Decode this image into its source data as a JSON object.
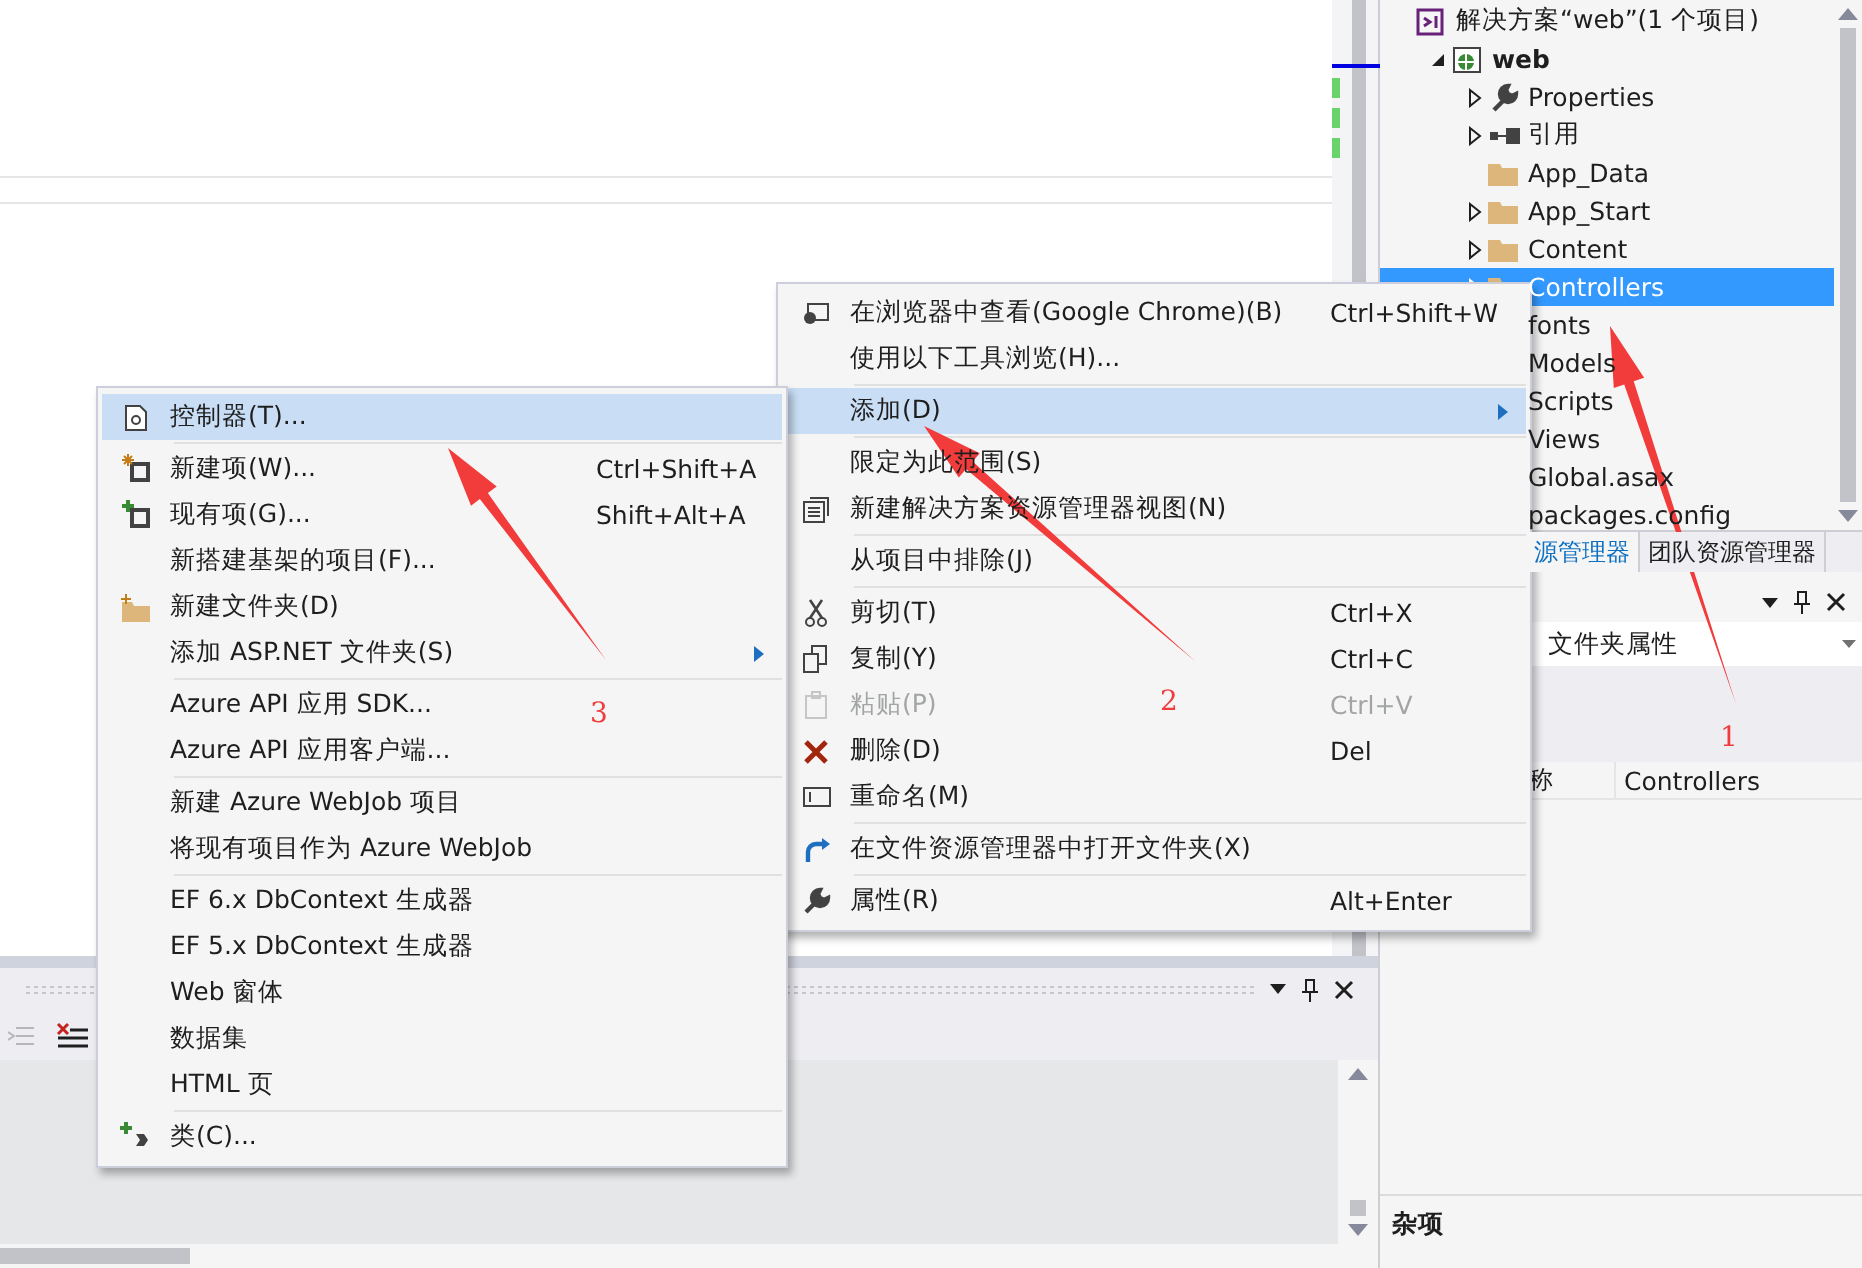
{
  "solution_explorer": {
    "tree": [
      {
        "label": "解决方案“web”(1 个项目)",
        "kind": "solution",
        "selected": false,
        "children": [
          {
            "label": "web",
            "kind": "web",
            "expanded": true,
            "selected": false,
            "children": [
              {
                "label": "Properties",
                "kind": "wrench",
                "expanded": false,
                "selected": false
              },
              {
                "label": "引用",
                "kind": "reference",
                "expanded": false,
                "selected": false
              },
              {
                "label": "App_Data",
                "kind": "folder",
                "selected": false
              },
              {
                "label": "App_Start",
                "kind": "folder",
                "expanded": false,
                "selected": false
              },
              {
                "label": "Content",
                "kind": "folder",
                "expanded": false,
                "selected": false
              },
              {
                "label": "Controllers",
                "kind": "folder",
                "expanded": false,
                "selected": true
              },
              {
                "label": "fonts",
                "selected": false
              },
              {
                "label": "Models",
                "selected": false
              },
              {
                "label": "Scripts",
                "selected": false
              },
              {
                "label": "Views",
                "selected": false
              },
              {
                "label": "Global.asax",
                "selected": false
              },
              {
                "label": "packages.config",
                "selected": false
              }
            ]
          }
        ]
      }
    ],
    "tabs": [
      {
        "label": "源管理器",
        "selected": true
      },
      {
        "label": "团队资源管理器",
        "selected": false
      }
    ]
  },
  "properties": {
    "object_type": "文件夹属性",
    "rows": [
      {
        "name": "称",
        "value": "Controllers"
      }
    ],
    "description_title": "杂项"
  },
  "context_menu": {
    "groups": [
      [
        {
          "kind": "browser",
          "label": "在浏览器中查看(Google Chrome)(B)",
          "shortcut": "Ctrl+Shift+W",
          "selected": false,
          "disabled": false,
          "submenu": false
        },
        {
          "label": "使用以下工具浏览(H)...",
          "selected": false,
          "disabled": false,
          "submenu": false
        }
      ],
      [
        {
          "label": "添加(D)",
          "selected": true,
          "disabled": false,
          "submenu": true
        }
      ],
      [
        {
          "label": "限定为此范围(S)",
          "selected": false,
          "disabled": false,
          "submenu": false
        },
        {
          "kind": "view",
          "label": "新建解决方案资源管理器视图(N)",
          "selected": false,
          "disabled": false,
          "submenu": false
        }
      ],
      [
        {
          "label": "从项目中排除(J)",
          "selected": false,
          "disabled": false,
          "submenu": false
        }
      ],
      [
        {
          "kind": "cut",
          "label": "剪切(T)",
          "shortcut": "Ctrl+X",
          "selected": false,
          "disabled": false,
          "submenu": false
        },
        {
          "kind": "copy",
          "label": "复制(Y)",
          "shortcut": "Ctrl+C",
          "selected": false,
          "disabled": false,
          "submenu": false
        },
        {
          "kind": "paste",
          "label": "粘贴(P)",
          "shortcut": "Ctrl+V",
          "selected": false,
          "disabled": true,
          "submenu": false
        },
        {
          "kind": "delete",
          "label": "删除(D)",
          "shortcut": "Del",
          "selected": false,
          "disabled": false,
          "submenu": false
        },
        {
          "kind": "rename",
          "label": "重命名(M)",
          "selected": false,
          "disabled": false,
          "submenu": false
        }
      ],
      [
        {
          "kind": "open",
          "label": "在文件资源管理器中打开文件夹(X)",
          "selected": false,
          "disabled": false,
          "submenu": false
        }
      ],
      [
        {
          "kind": "wrench",
          "label": "属性(R)",
          "shortcut": "Alt+Enter",
          "selected": false,
          "disabled": false,
          "submenu": false
        }
      ]
    ]
  },
  "add_menu": {
    "groups": [
      [
        {
          "kind": "controller",
          "label": "控制器(T)...",
          "selected": true,
          "submenu": false
        }
      ],
      [
        {
          "kind": "new-item",
          "label": "新建项(W)...",
          "shortcut": "Ctrl+Shift+A",
          "selected": false,
          "submenu": false
        },
        {
          "kind": "existing-item",
          "label": "现有项(G)...",
          "shortcut": "Shift+Alt+A",
          "selected": false,
          "submenu": false
        },
        {
          "label": "新搭建基架的项目(F)...",
          "selected": false,
          "submenu": false
        },
        {
          "kind": "new-folder",
          "label": "新建文件夹(D)",
          "selected": false,
          "submenu": false
        },
        {
          "label": "添加 ASP.NET 文件夹(S)",
          "selected": false,
          "submenu": true
        }
      ],
      [
        {
          "label": "Azure API 应用 SDK...",
          "selected": false,
          "submenu": false
        },
        {
          "label": "Azure API 应用客户端...",
          "selected": false,
          "submenu": false
        }
      ],
      [
        {
          "label": "新建 Azure WebJob 项目",
          "selected": false,
          "submenu": false
        },
        {
          "label": "将现有项目作为 Azure WebJob",
          "selected": false,
          "submenu": false
        }
      ],
      [
        {
          "label": "EF 6.x DbContext 生成器",
          "selected": false,
          "submenu": false
        },
        {
          "label": "EF 5.x DbContext 生成器",
          "selected": false,
          "submenu": false
        },
        {
          "label": "Web 窗体",
          "selected": false,
          "submenu": false
        },
        {
          "label": "数据集",
          "selected": false,
          "submenu": false
        },
        {
          "label": "HTML 页",
          "selected": false,
          "submenu": false
        }
      ],
      [
        {
          "kind": "class",
          "label": "类(C)...",
          "selected": false,
          "submenu": false
        }
      ]
    ]
  },
  "annotations": [
    {
      "label": "1"
    },
    {
      "label": "2"
    },
    {
      "label": "3"
    }
  ]
}
